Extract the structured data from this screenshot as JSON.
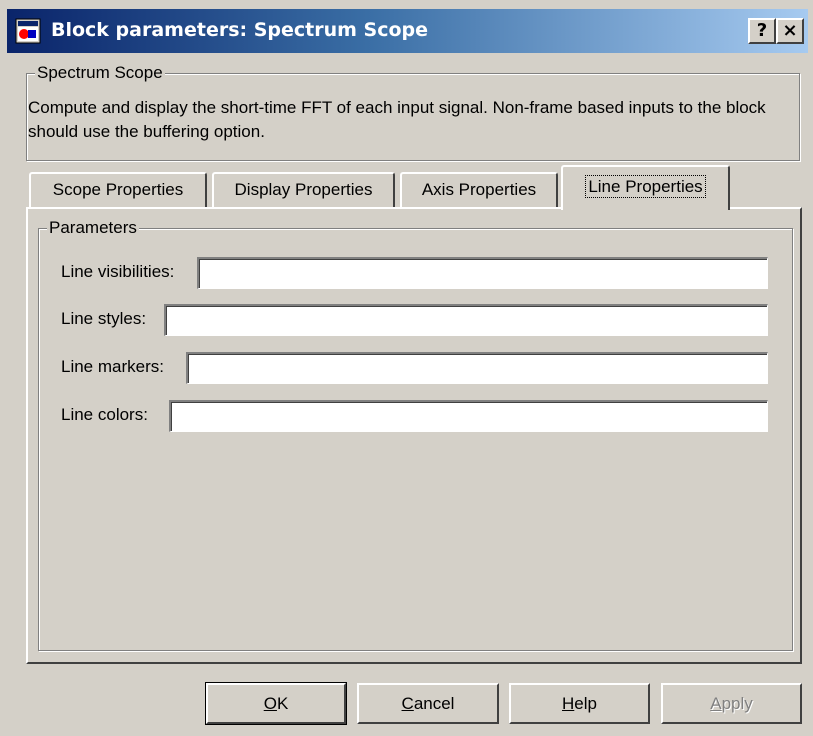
{
  "window": {
    "title": "Block parameters: Spectrum Scope",
    "help_label": "?",
    "close_label": "×",
    "app_icon": "simulink-block-icon",
    "titlebar_color": "#0a246a"
  },
  "description": {
    "group_title": "Spectrum Scope",
    "text": "Compute and display the short-time FFT of each input signal.  Non-frame based inputs to the block should use the buffering option."
  },
  "tabs": [
    {
      "label": "Scope Properties",
      "active": false
    },
    {
      "label": "Display Properties",
      "active": false
    },
    {
      "label": "Axis Properties",
      "active": false
    },
    {
      "label": "Line Properties",
      "active": true
    }
  ],
  "parameters": {
    "group_title": "Parameters",
    "fields": [
      {
        "label": "Line visibilities:",
        "value": ""
      },
      {
        "label": "Line styles:",
        "value": ""
      },
      {
        "label": "Line markers:",
        "value": ""
      },
      {
        "label": "Line colors:",
        "value": ""
      }
    ]
  },
  "buttons": {
    "ok": {
      "mnemonic": "O",
      "rest": "K"
    },
    "cancel": {
      "mnemonic": "C",
      "rest": "ancel"
    },
    "help": {
      "mnemonic": "H",
      "rest": "elp"
    },
    "apply": {
      "mnemonic": "A",
      "rest": "pply",
      "enabled": false
    }
  }
}
